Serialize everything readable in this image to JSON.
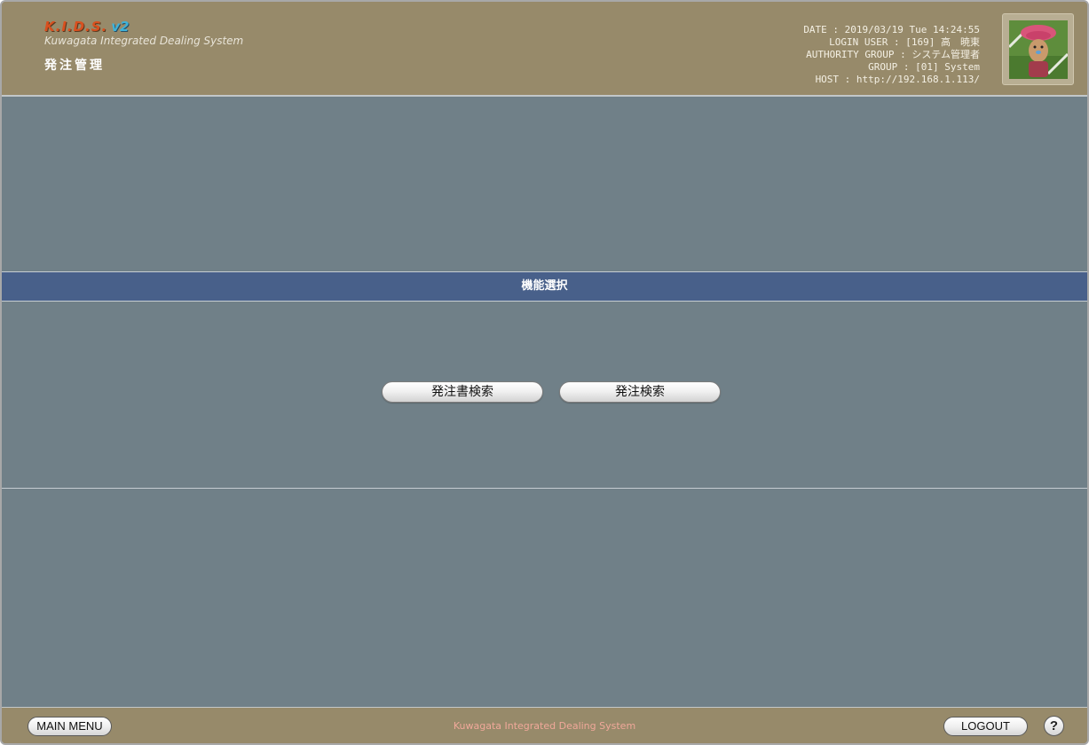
{
  "header": {
    "logo_kids": "K.I.D.S.",
    "logo_version": "v2",
    "logo_subtitle": "Kuwagata Integrated Dealing System",
    "module_title": "発注管理",
    "info": {
      "date": "DATE : 2019/03/19 Tue 14:24:55",
      "login_user": "LOGIN USER : [169] 高　暁東",
      "authority_group": "AUTHORITY GROUP : システム管理者",
      "group": "GROUP : [01] System",
      "host": "HOST : http://192.168.1.113/"
    },
    "avatar_icon": "user-avatar-icon"
  },
  "function_select": {
    "title": "機能選択",
    "buttons": [
      {
        "label": "発注書検索"
      },
      {
        "label": "発注検索"
      }
    ]
  },
  "footer": {
    "main_menu_label": "MAIN MENU",
    "center_text": "Kuwagata Integrated Dealing System",
    "logout_label": "LOGOUT",
    "help_label": "?"
  },
  "colors": {
    "header_bg": "#978a6a",
    "body_bg": "#708088",
    "band_bg": "#48608a",
    "footer_text": "#f0a89a",
    "logo_kids": "#d9501f",
    "logo_v2": "#3fb2d9"
  }
}
